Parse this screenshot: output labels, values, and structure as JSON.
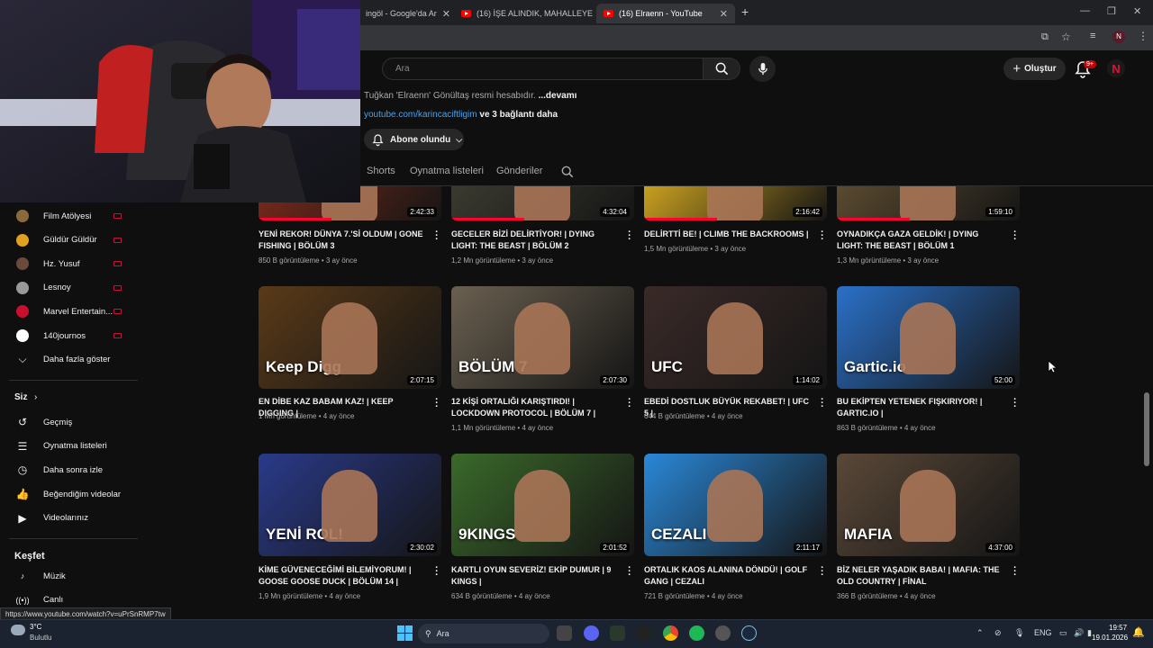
{
  "browser": {
    "tabs": [
      {
        "label": "ingöl - Google'da Ar",
        "active": false
      },
      {
        "label": "(16) İŞE ALINDIK, MAHALLEYE A",
        "active": false
      },
      {
        "label": "(16) Elraenn - YouTube",
        "active": true
      }
    ],
    "new_tab": "+",
    "status_url": "https://www.youtube.com/watch?v=uPrSnRMP7tw"
  },
  "header": {
    "search_placeholder": "Ara",
    "create_label": "Oluştur",
    "notif_count": "9+",
    "avatar_letter": "N"
  },
  "channel": {
    "description": "Tuğkan 'Elraenn' Gönültaş resmi hesabıdır.",
    "more": "...devamı",
    "link": "youtube.com/karincaciftligim",
    "link_more": "ve 3 bağlantı daha",
    "subscribed_label": "Abone olundu",
    "tabs": [
      "Shorts",
      "Oynatma listeleri",
      "Gönderiler"
    ]
  },
  "sidebar": {
    "subscriptions": [
      {
        "label": "Film Atölyesi",
        "color": "#8a6a3a"
      },
      {
        "label": "Güldür Güldür",
        "color": "#e0a020"
      },
      {
        "label": "Hz. Yusuf",
        "color": "#6a4a3a"
      },
      {
        "label": "Lesnoy",
        "color": "#999999"
      },
      {
        "label": "Marvel Entertain...",
        "color": "#c8102e"
      },
      {
        "label": "140journos",
        "color": "#ffffff"
      }
    ],
    "show_more": "Daha fazla göster",
    "you_label": "Siz",
    "you_items": [
      {
        "label": "Geçmiş",
        "icon": "history-icon"
      },
      {
        "label": "Oynatma listeleri",
        "icon": "playlist-icon"
      },
      {
        "label": "Daha sonra izle",
        "icon": "clock-icon"
      },
      {
        "label": "Beğendiğim videolar",
        "icon": "like-icon"
      },
      {
        "label": "Videolarınız",
        "icon": "video-icon"
      }
    ],
    "explore_label": "Keşfet",
    "explore_items": [
      {
        "label": "Müzik",
        "icon": "music-icon"
      },
      {
        "label": "Canlı",
        "icon": "live-icon"
      }
    ]
  },
  "videos": [
    {
      "title": "YENİ REKOR! DÜNYA 7.'Sİ OLDUM | GONE FISHING | BÖLÜM 3",
      "views": "850 B görüntüleme",
      "age": "3 ay önce",
      "duration": "2:42:33",
      "color": "#7a2a1a"
    },
    {
      "title": "GECELER BİZİ DELİRTİYOR! | DYING LIGHT: THE BEAST | BÖLÜM 2",
      "views": "1,2 Mn görüntüleme",
      "age": "3 ay önce",
      "duration": "4:32:04",
      "color": "#3a3a30"
    },
    {
      "title": "DELİRTTİ BE! | CLIMB THE BACKROOMS |",
      "views": "1,5 Mn görüntüleme",
      "age": "3 ay önce",
      "duration": "2:16:42",
      "color": "#c8a020"
    },
    {
      "title": "OYNADIKÇA GAZA GELDİK! | DYING LIGHT: THE BEAST | BÖLÜM 1",
      "views": "1,3 Mn görüntüleme",
      "age": "3 ay önce",
      "duration": "1:59:10",
      "color": "#5a4a30"
    },
    {
      "title": "EN DİBE KAZ BABAM KAZ! | KEEP DIGGING |",
      "views": "1 Mn görüntüleme",
      "age": "4 ay önce",
      "duration": "2:07:15",
      "color": "#5a3a18",
      "text": "Keep Digg"
    },
    {
      "title": "12 KİŞİ ORTALIĞI KARIŞTIRDI! | LOCKDOWN PROTOCOL | BÖLÜM 7 |",
      "views": "1,1 Mn görüntüleme",
      "age": "4 ay önce",
      "duration": "2:07:30",
      "color": "#6a6050",
      "text": "BÖLÜM 7"
    },
    {
      "title": "EBEDİ DOSTLUK BÜYÜK REKABET! | UFC 5 |",
      "views": "644 B görüntüleme",
      "age": "4 ay önce",
      "duration": "1:14:02",
      "color": "#3a2a28",
      "text": "UFC"
    },
    {
      "title": "BU EKİPTEN YETENEK FIŞKIRIYOR! | GARTIC.IO |",
      "views": "863 B görüntüleme",
      "age": "4 ay önce",
      "duration": "52:00",
      "color": "#2a70c8",
      "text": "Gartic.io"
    },
    {
      "title": "KİME GÜVENECEĞİMİ BİLEMİYORUM! | GOOSE GOOSE DUCK | BÖLÜM 14 |",
      "views": "1,9 Mn görüntüleme",
      "age": "4 ay önce",
      "duration": "2:30:02",
      "color": "#2a3a8a",
      "text": "YENİ ROL!"
    },
    {
      "title": "KARTLI OYUN SEVERİZ! EKİP DUMUR | 9 KINGS |",
      "views": "634 B görüntüleme",
      "age": "4 ay önce",
      "duration": "2:01:52",
      "color": "#3a6a2a",
      "text": "9KINGS"
    },
    {
      "title": "ORTALIK KAOS ALANINA DÖNDÜ! | GOLF GANG | CEZALI",
      "views": "721 B görüntüleme",
      "age": "4 ay önce",
      "duration": "2:11:17",
      "color": "#2a88d8",
      "text": "CEZALI"
    },
    {
      "title": "BİZ NELER YAŞADIK BABA! | MAFIA: THE OLD COUNTRY | FİNAL",
      "views": "366 B görüntüleme",
      "age": "4 ay önce",
      "duration": "4:37:00",
      "color": "#5a4838",
      "text": "MAFIA"
    }
  ],
  "taskbar": {
    "weather_temp": "3°C",
    "weather_desc": "Bulutlu",
    "search_label": "Ara",
    "lang": "ENG",
    "time": "19:57",
    "date": "19.01.2026"
  }
}
